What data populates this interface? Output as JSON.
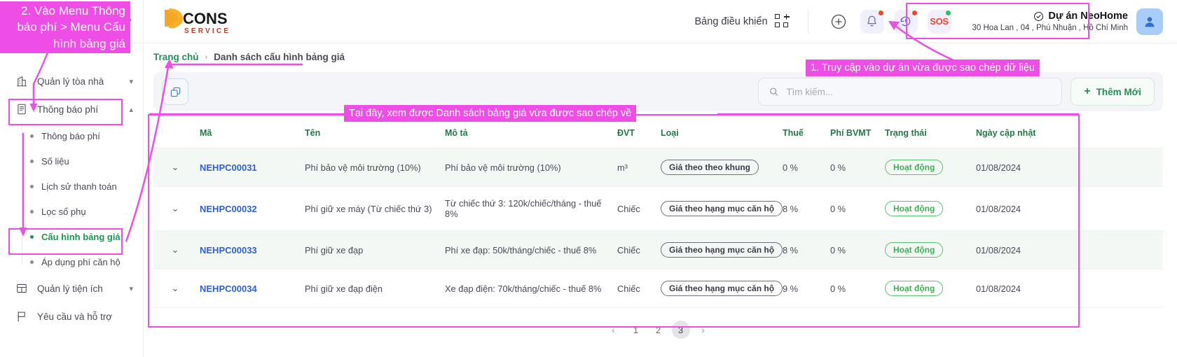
{
  "header": {
    "collapse_icon": "chevron-down-icon",
    "logo_main": "CONS",
    "logo_sub": "SERVICE",
    "dashboard_label": "Bảng điều khiển",
    "add_icon": "plus-circle-icon",
    "bell_icon": "bell-icon",
    "history_icon": "history-clock-icon",
    "sos_label": "SOS",
    "project_name": "Dự án NeoHome",
    "project_address": "30 Hoa Lan , 04 , Phú Nhuận , Hồ Chí Minh",
    "avatar_icon": "user-avatar-icon"
  },
  "sidebar": {
    "items": [
      {
        "label": "Quản lý tòa nhà",
        "icon": "building-icon",
        "chevron": "⌄",
        "expanded": false
      },
      {
        "label": "Thông báo phí",
        "icon": "invoice-icon",
        "chevron": "⌃",
        "expanded": true
      },
      {
        "label": "Quản lý tiện ích",
        "icon": "layout-icon",
        "chevron": "⌄",
        "expanded": false
      },
      {
        "label": "Yêu cầu và hỗ trợ",
        "icon": "flag-icon",
        "chevron": "",
        "expanded": false
      }
    ],
    "sub_items": [
      {
        "label": "Thông báo phí",
        "active": false
      },
      {
        "label": "Số liệu",
        "active": false
      },
      {
        "label": "Lịch sử thanh toán",
        "active": false
      },
      {
        "label": "Lọc sổ phụ",
        "active": false
      },
      {
        "label": "Cấu hình bảng giá",
        "active": true
      },
      {
        "label": "Áp dụng phí căn hộ",
        "active": false
      }
    ]
  },
  "breadcrumb": {
    "home": "Trang chủ",
    "separator": "›",
    "current": "Danh sách cấu hình bảng giá"
  },
  "toolbar": {
    "copy_icon": "copy-icon",
    "search_icon": "search-icon",
    "search_placeholder": "Tìm kiếm...",
    "search_value": "",
    "add_new_label": "Thêm Mới",
    "add_new_icon": "plus-icon"
  },
  "table": {
    "columns": [
      "",
      "Mã",
      "Tên",
      "Mô tả",
      "ĐVT",
      "Loại",
      "Thuế",
      "Phí BVMT",
      "Trạng thái",
      "Ngày cập nhật"
    ],
    "rows": [
      {
        "expand": "⌄",
        "code": "NEHPC00031",
        "name": "Phí bảo vệ môi trường (10%)",
        "desc": "Phí bảo vệ môi trường (10%)",
        "unit": "m³",
        "type": "Giá theo theo khung",
        "tax": "0 %",
        "bvmt": "0 %",
        "status": "Hoạt động",
        "updated": "01/08/2024"
      },
      {
        "expand": "⌄",
        "code": "NEHPC00032",
        "name": "Phí giữ xe máy (Từ chiếc thứ 3)",
        "desc": "Từ chiếc thứ 3: 120k/chiếc/tháng - thuế 8%",
        "unit": "Chiếc",
        "type": "Giá theo hạng mục căn hộ",
        "tax": "8 %",
        "bvmt": "0 %",
        "status": "Hoạt động",
        "updated": "01/08/2024"
      },
      {
        "expand": "⌄",
        "code": "NEHPC00033",
        "name": "Phí giữ xe đạp",
        "desc": "Phí xe đạp: 50k/tháng/chiếc - thuế 8%",
        "unit": "Chiếc",
        "type": "Giá theo hạng mục căn hộ",
        "tax": "8 %",
        "bvmt": "0 %",
        "status": "Hoạt động",
        "updated": "01/08/2024"
      },
      {
        "expand": "⌄",
        "code": "NEHPC00034",
        "name": "Phí giữ xe đạp điện",
        "desc": "Xe đạp điện: 70k/tháng/chiếc - thuế 8%",
        "unit": "Chiếc",
        "type": "Giá theo hạng mục căn hộ",
        "tax": "9 %",
        "bvmt": "0 %",
        "status": "Hoạt động",
        "updated": "01/08/2024"
      }
    ]
  },
  "pagination": {
    "prev": "‹",
    "pages": [
      "1",
      "2",
      "3"
    ],
    "active": "3",
    "next": "›"
  },
  "annotations": {
    "step2": "2. Vào Menu Thông báo phí > Menu Cấu hình bảng giá",
    "step1": "1. Truy cập vào dự án vừa được sao chép dữ liệu",
    "step3": "Tại đây, xem được Danh sách bảng giá vừa được sao chép về"
  },
  "colors": {
    "accent_pink": "#ee4ee6",
    "green": "#1f9254",
    "link_blue": "#2f5fd8",
    "red": "#f0462d"
  }
}
